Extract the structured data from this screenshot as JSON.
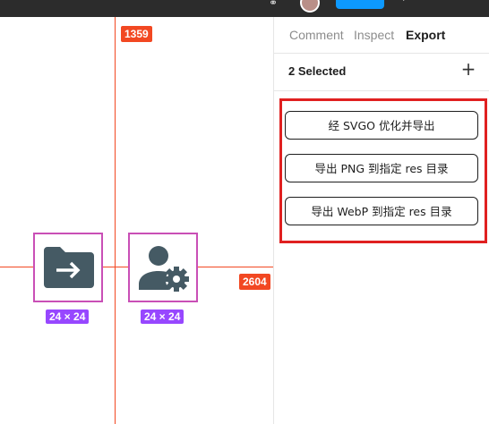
{
  "topbar": {
    "link_icon": "link-icon",
    "avatar_icon": "avatar",
    "share_button_label": "",
    "play_icon": "play-icon"
  },
  "canvas": {
    "x_coordinate": "1359",
    "y_coordinate": "2604",
    "guide_color": "#f24822",
    "frames": [
      {
        "icon": "folder-move-icon",
        "size": "24 × 24"
      },
      {
        "icon": "user-settings-icon",
        "size": "24 × 24"
      }
    ],
    "frame_border_color": "#c94fb6",
    "size_badge_color": "#9747ff",
    "icon_color": "#455a64"
  },
  "panel": {
    "tabs": [
      {
        "label": "Comment",
        "active": false
      },
      {
        "label": "Inspect",
        "active": false
      },
      {
        "label": "Export",
        "active": true
      }
    ],
    "selection_title": "2 Selected",
    "add_icon": "plus-icon",
    "actions": [
      {
        "label": "经 SVGO 优化并导出"
      },
      {
        "label": "导出 PNG 到指定 res 目录"
      },
      {
        "label": "导出 WebP 到指定 res 目录"
      }
    ],
    "highlight_color": "#e02020"
  }
}
